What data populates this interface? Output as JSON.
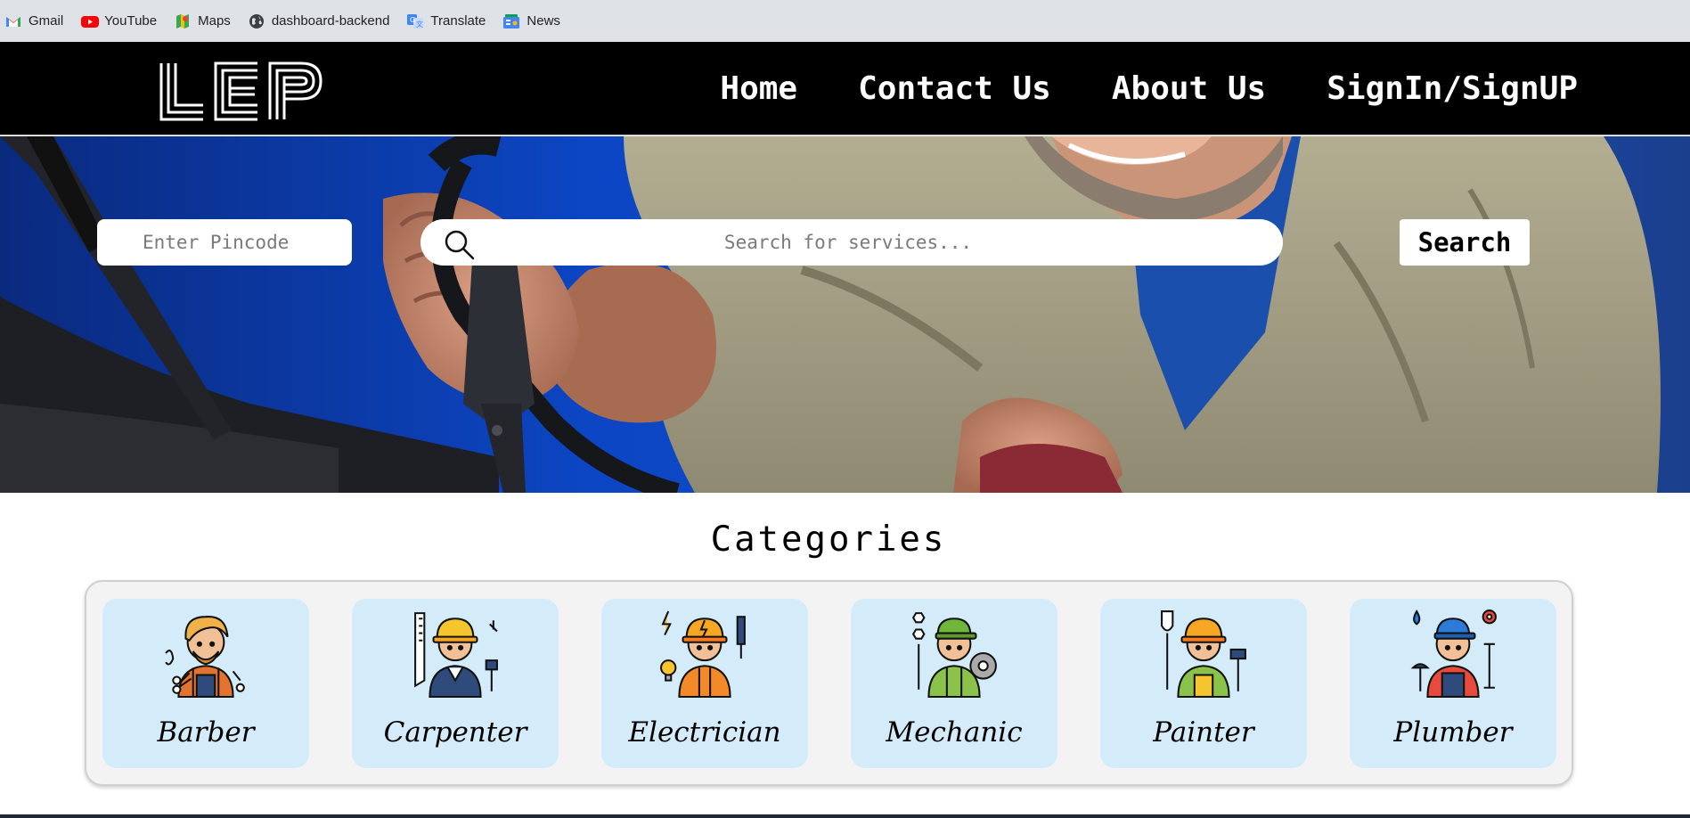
{
  "bookmarks": [
    {
      "label": "Gmail",
      "icon": "gmail-icon"
    },
    {
      "label": "YouTube",
      "icon": "youtube-icon"
    },
    {
      "label": "Maps",
      "icon": "maps-icon"
    },
    {
      "label": "dashboard-backend",
      "icon": "globe-icon"
    },
    {
      "label": "Translate",
      "icon": "translate-icon"
    },
    {
      "label": "News",
      "icon": "news-icon"
    }
  ],
  "brand": {
    "logo_text": "LEP"
  },
  "nav": {
    "home": "Home",
    "contact": "Contact Us",
    "about": "About Us",
    "signin": "SignIn/SignUP"
  },
  "hero": {
    "pincode_placeholder": "Enter Pincode",
    "search_placeholder": "Search for services...",
    "search_button": "Search"
  },
  "categories": {
    "title": "Categories",
    "items": [
      {
        "label": "Barber",
        "icon": "barber-icon"
      },
      {
        "label": "Carpenter",
        "icon": "carpenter-icon"
      },
      {
        "label": "Electrician",
        "icon": "electrician-icon"
      },
      {
        "label": "Mechanic",
        "icon": "mechanic-icon"
      },
      {
        "label": "Painter",
        "icon": "painter-icon"
      },
      {
        "label": "Plumber",
        "icon": "plumber-icon"
      }
    ]
  },
  "colors": {
    "nav_bg": "#000000",
    "card_bg": "#d4ecf9",
    "panel_bg": "#f3f3f3",
    "bookmark_bar": "#dee1e6"
  }
}
